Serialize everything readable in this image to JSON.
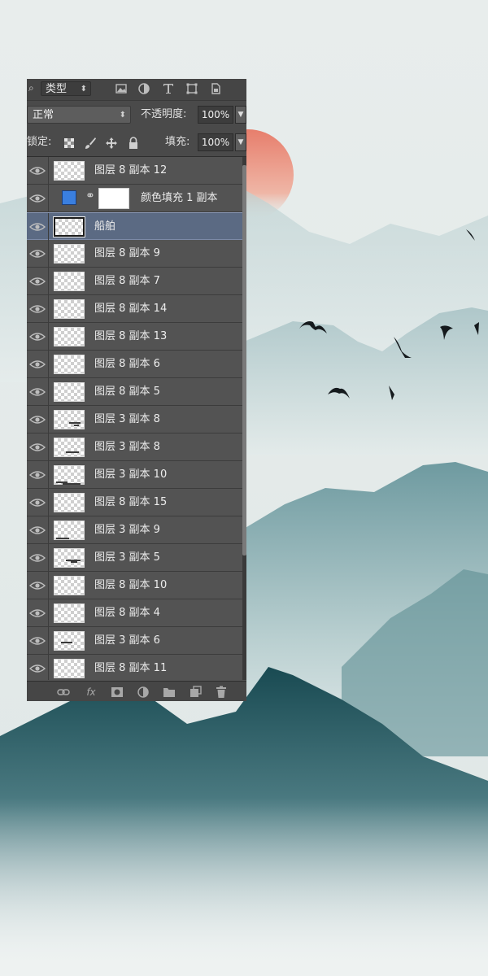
{
  "panel": {
    "filter_kind": "类型",
    "blend_mode": "正常",
    "opacity_label": "不透明度:",
    "opacity_value": "100%",
    "lock_label": "锁定:",
    "fill_label": "填充:",
    "fill_value": "100%"
  },
  "layers": [
    {
      "name": "图层 8 副本 12",
      "type": "pixel",
      "selected": false,
      "visible": true
    },
    {
      "name": "颜色填充 1 副本",
      "type": "color-fill",
      "fill_color": "#3a7fe0",
      "selected": false,
      "visible": true
    },
    {
      "name": "船舶",
      "type": "pixel",
      "selected": true,
      "visible": true
    },
    {
      "name": "图层 8 副本 9",
      "type": "pixel",
      "selected": false,
      "visible": true
    },
    {
      "name": "图层 8 副本 7",
      "type": "pixel",
      "selected": false,
      "visible": true
    },
    {
      "name": "图层 8 副本 14",
      "type": "pixel",
      "selected": false,
      "visible": true
    },
    {
      "name": "图层 8 副本 13",
      "type": "pixel",
      "selected": false,
      "visible": true
    },
    {
      "name": "图层 8 副本 6",
      "type": "pixel",
      "selected": false,
      "visible": true
    },
    {
      "name": "图层 8 副本 5",
      "type": "pixel",
      "selected": false,
      "visible": true
    },
    {
      "name": "图层 3 副本 8",
      "type": "pixel",
      "selected": false,
      "visible": true
    },
    {
      "name": "图层 3 副本 8",
      "type": "pixel",
      "selected": false,
      "visible": true
    },
    {
      "name": "图层 3 副本 10",
      "type": "pixel",
      "selected": false,
      "visible": true
    },
    {
      "name": "图层 8 副本 15",
      "type": "pixel",
      "selected": false,
      "visible": true
    },
    {
      "name": "图层 3 副本 9",
      "type": "pixel",
      "selected": false,
      "visible": true
    },
    {
      "name": "图层 3 副本 5",
      "type": "pixel",
      "selected": false,
      "visible": true
    },
    {
      "name": "图层 8 副本 10",
      "type": "pixel",
      "selected": false,
      "visible": true
    },
    {
      "name": "图层 8 副本 4",
      "type": "pixel",
      "selected": false,
      "visible": true
    },
    {
      "name": "图层 3 副本 6",
      "type": "pixel",
      "selected": false,
      "visible": true
    },
    {
      "name": "图层 8 副本 11",
      "type": "pixel",
      "selected": false,
      "visible": true
    }
  ],
  "colors": {
    "panel_bg": "#535353",
    "selected_row": "#5b6a83",
    "sun": "#e88a78",
    "mountain_dark": "#1f4d55",
    "sky": "#e6ebea"
  },
  "icons": {
    "filter_icons": [
      "image-filter-icon",
      "adjustment-filter-icon",
      "type-filter-icon",
      "shape-filter-icon",
      "smart-object-filter-icon"
    ],
    "lock_icons": [
      "lock-transparent-icon",
      "lock-paint-icon",
      "lock-position-icon",
      "lock-all-icon"
    ],
    "footer_icons": [
      "link-layers-icon",
      "fx-icon",
      "add-mask-icon",
      "new-adjustment-icon",
      "new-group-icon",
      "new-layer-icon",
      "delete-layer-icon"
    ]
  }
}
